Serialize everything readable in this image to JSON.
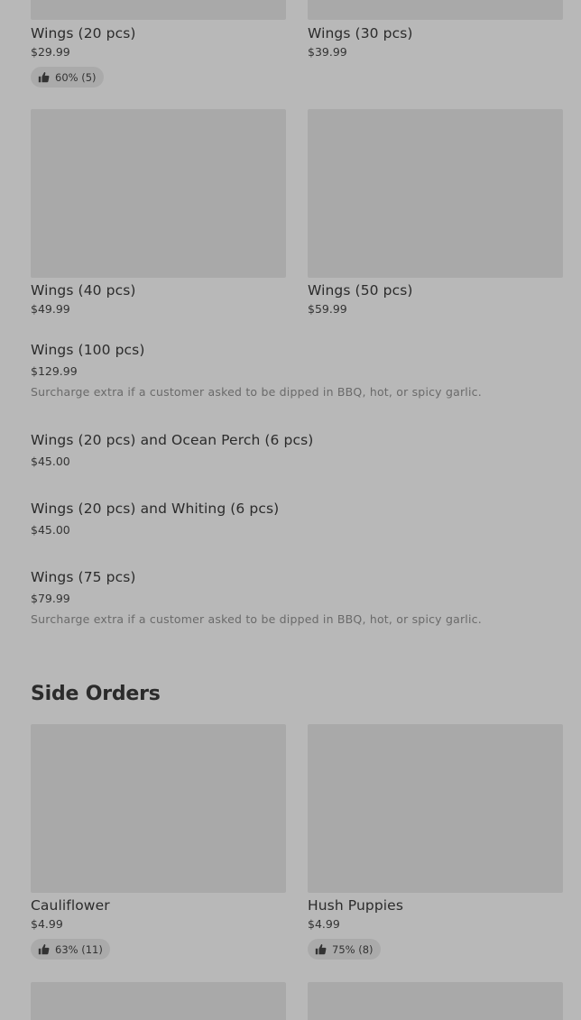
{
  "menu": {
    "row1": [
      {
        "name": "Wings (20 pcs)",
        "price": "$29.99",
        "rating": "60% (5)"
      },
      {
        "name": "Wings (30 pcs)",
        "price": "$39.99"
      }
    ],
    "row2": [
      {
        "name": "Wings (40 pcs)",
        "price": "$49.99"
      },
      {
        "name": "Wings (50 pcs)",
        "price": "$59.99"
      }
    ],
    "list": [
      {
        "name": "Wings (100 pcs)",
        "price": "$129.99",
        "description": "Surcharge extra if a customer asked to be dipped in BBQ, hot, or spicy garlic."
      },
      {
        "name": "Wings (20 pcs) and Ocean Perch (6 pcs)",
        "price": "$45.00"
      },
      {
        "name": "Wings (20 pcs) and Whiting (6 pcs)",
        "price": "$45.00"
      },
      {
        "name": "Wings (75 pcs)",
        "price": "$79.99",
        "description": "Surcharge extra if a customer asked to be dipped in BBQ, hot, or spicy garlic."
      }
    ]
  },
  "side_orders": {
    "title": "Side Orders",
    "items": [
      {
        "name": "Cauliflower",
        "price": "$4.99",
        "rating": "63% (11)"
      },
      {
        "name": "Hush Puppies",
        "price": "$4.99",
        "rating": "75% (8)"
      }
    ]
  },
  "icons": {
    "rating": "thumbs-up-icon"
  },
  "colors": {
    "background": "#b8b8b8",
    "placeholder": "#a9a9a9",
    "badge": "#aaaaaa"
  }
}
